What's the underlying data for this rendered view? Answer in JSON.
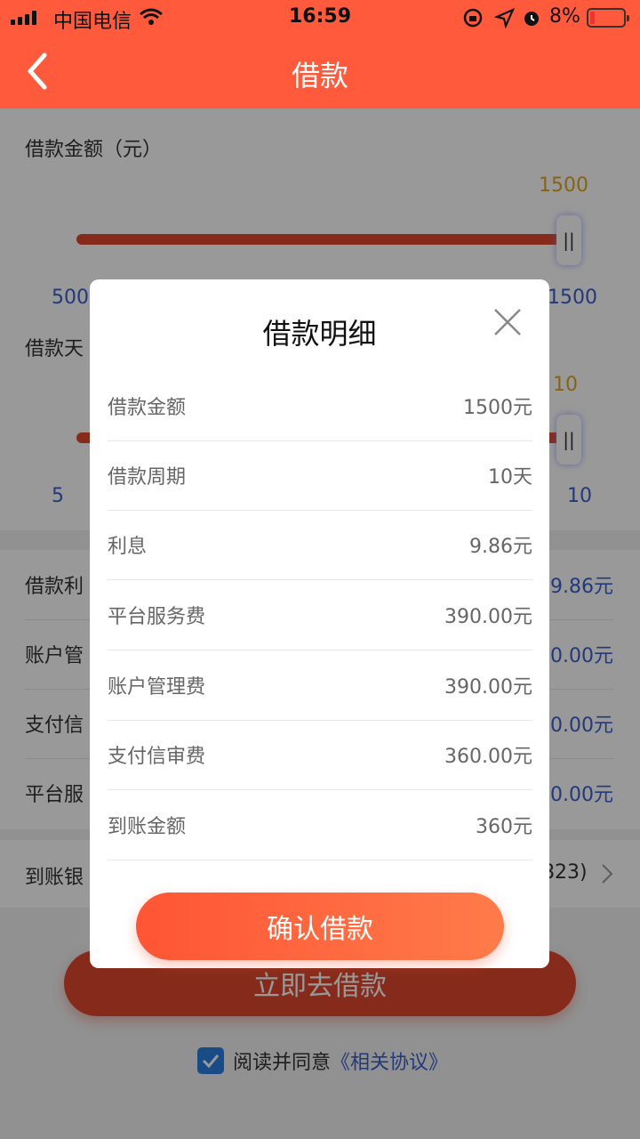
{
  "status_bar": {
    "carrier": "中国电信",
    "time": "16:59",
    "battery_pct": "8%",
    "icons": [
      "signal-icon",
      "wifi-icon",
      "rotation-lock-icon",
      "location-icon",
      "alarm-icon",
      "battery-icon"
    ]
  },
  "nav": {
    "title": "借款",
    "back_icon": "chevron-left-icon"
  },
  "amount_section": {
    "label": "借款金额（元）",
    "current": "1500",
    "min": "500",
    "max": "1500",
    "fill_fraction": 1.0
  },
  "days_section": {
    "label": "借款天",
    "current": "10",
    "min": "5",
    "max": "10",
    "fill_fraction": 1.0
  },
  "fees": [
    {
      "label": "借款利",
      "value": "9.86元"
    },
    {
      "label": "账户管",
      "value": "0.00元"
    },
    {
      "label": "支付信",
      "value": "0.00元"
    },
    {
      "label": "平台服",
      "value": "0.00元"
    }
  ],
  "bank": {
    "label": "到账银",
    "value": "823)"
  },
  "go_button": "立即去借款",
  "agreement": {
    "text": "阅读并同意",
    "link": "《相关协议》"
  },
  "modal": {
    "title": "借款明细",
    "rows": [
      {
        "label": "借款金额",
        "value": "1500元"
      },
      {
        "label": "借款周期",
        "value": "10天"
      },
      {
        "label": "利息",
        "value": "9.86元"
      },
      {
        "label": "平台服务费",
        "value": "390.00元"
      },
      {
        "label": "账户管理费",
        "value": "390.00元"
      },
      {
        "label": "支付信审费",
        "value": "360.00元"
      },
      {
        "label": "到账金额",
        "value": "360元"
      }
    ],
    "confirm": "确认借款"
  },
  "colors": {
    "brand": "#ff5a3c",
    "slider": "#e0492e",
    "link": "#3a5fcd",
    "accent": "#e0a623"
  }
}
